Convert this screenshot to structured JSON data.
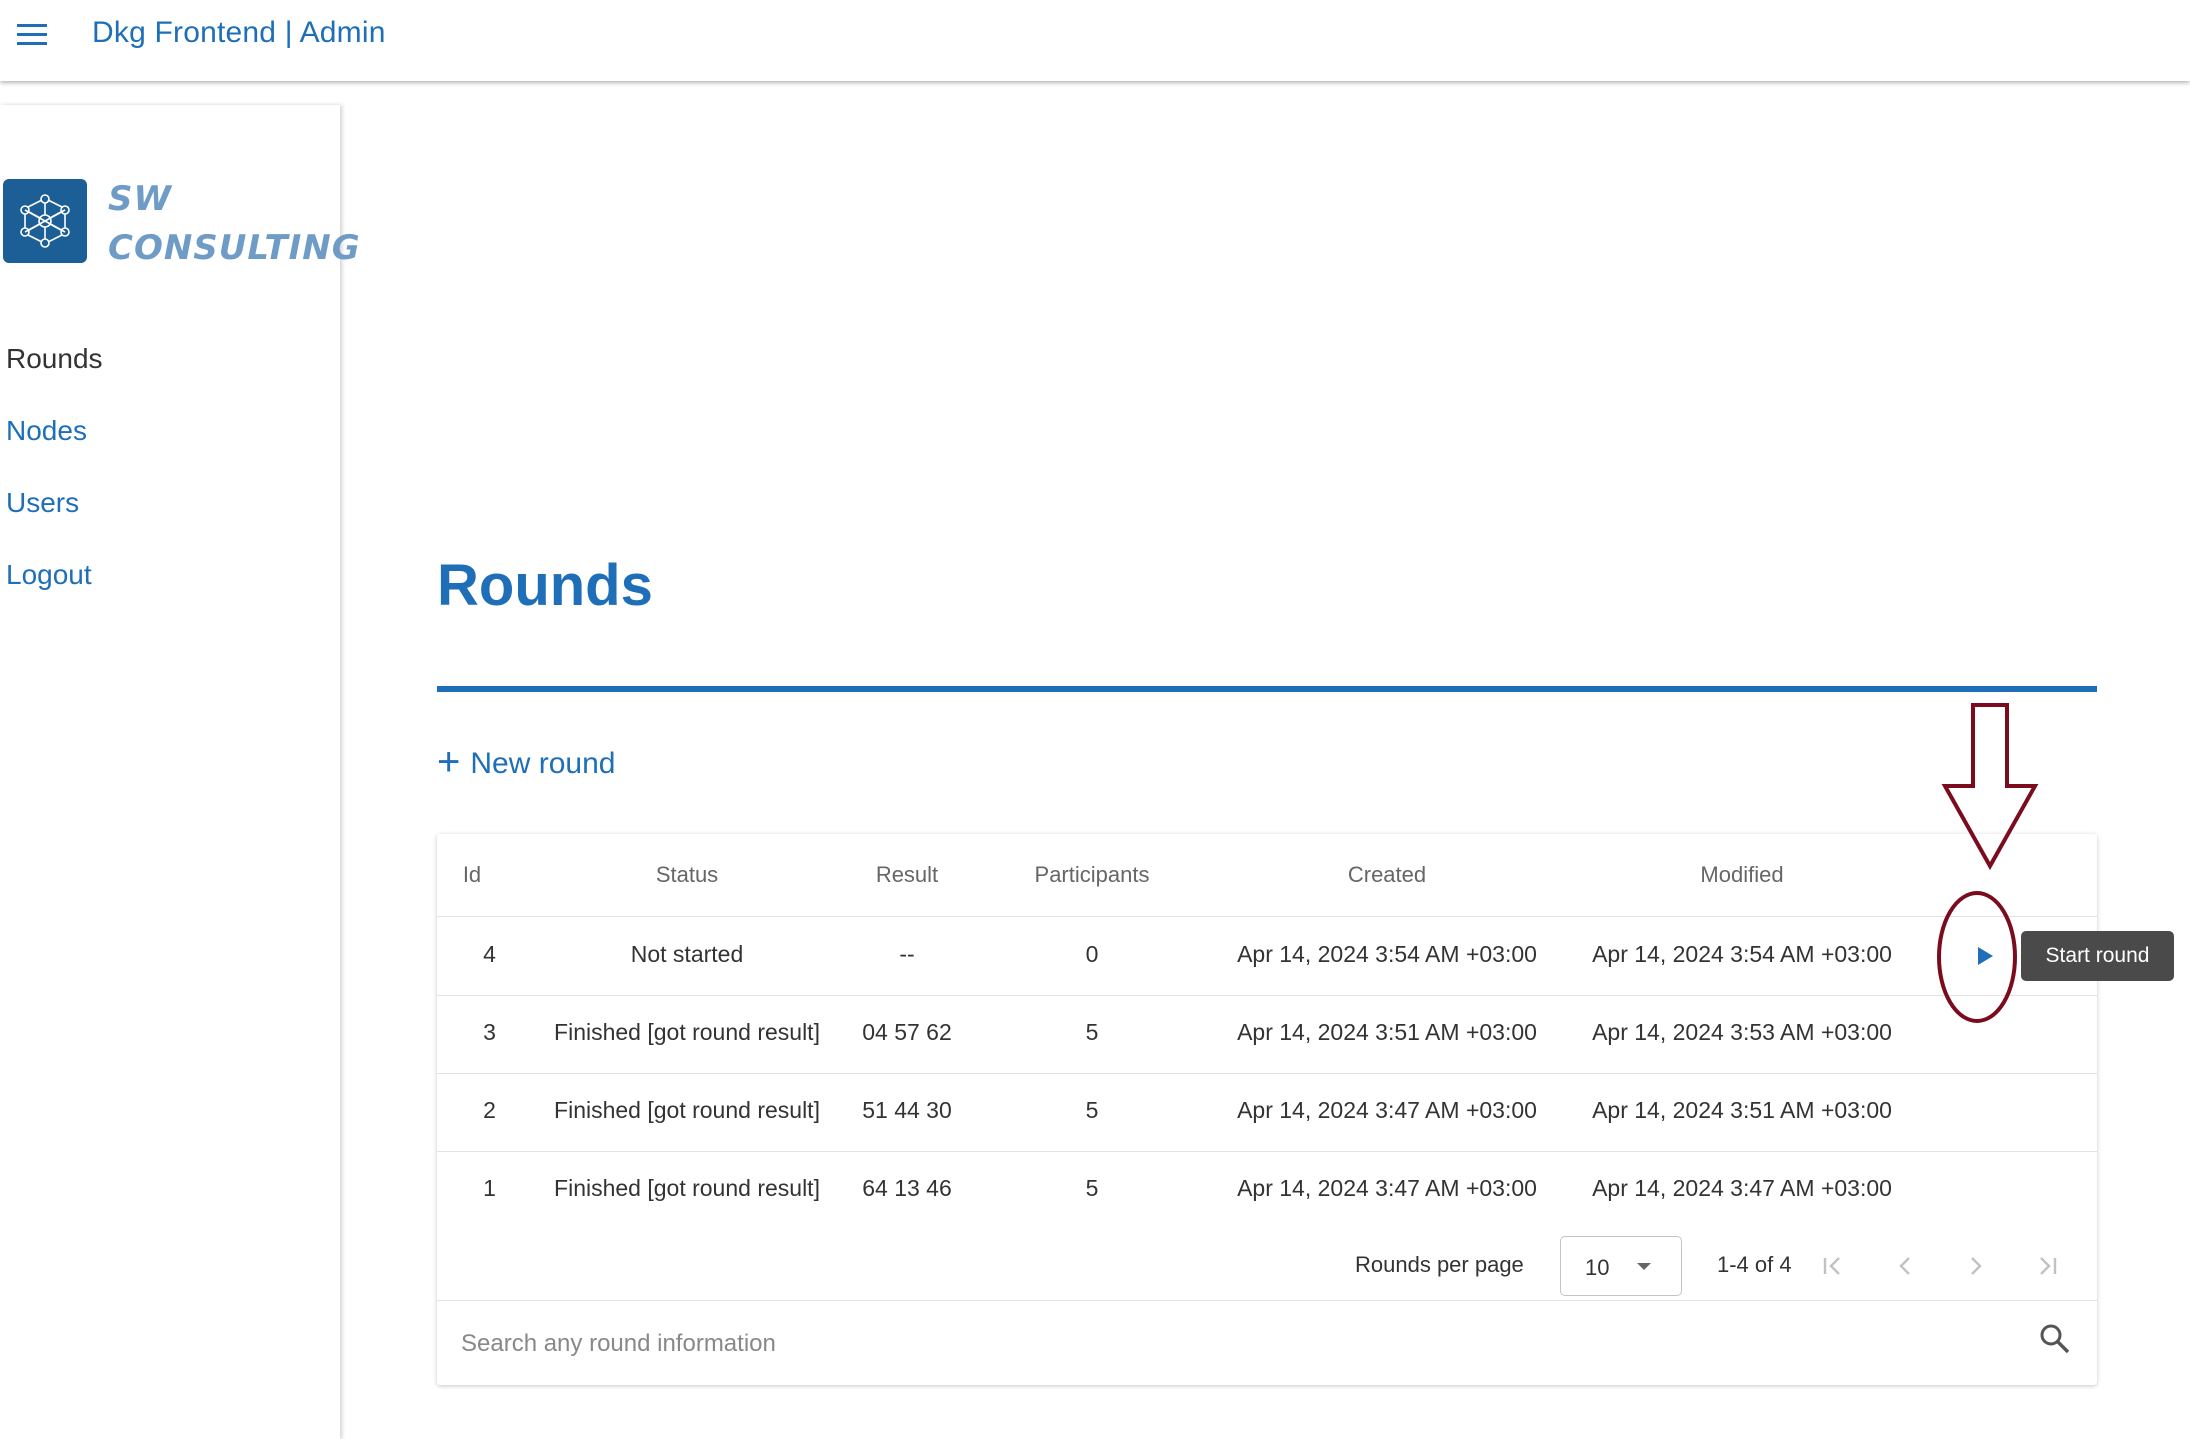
{
  "app": {
    "title": "Dkg Frontend | Admin"
  },
  "logo": {
    "line1": "SW",
    "line2": "CONSULTING"
  },
  "sidebar": {
    "items": [
      {
        "label": "Rounds",
        "active": true
      },
      {
        "label": "Nodes",
        "active": false
      },
      {
        "label": "Users",
        "active": false
      },
      {
        "label": "Logout",
        "active": false
      }
    ]
  },
  "page": {
    "title": "Rounds"
  },
  "toolbar": {
    "new_round_label": "New round"
  },
  "table": {
    "columns": [
      "Id",
      "Status",
      "Result",
      "Participants",
      "Created",
      "Modified"
    ],
    "rows": [
      {
        "id": "4",
        "status": "Not started",
        "result": "--",
        "participants": "0",
        "created": "Apr 14, 2024 3:54 AM +03:00",
        "modified": "Apr 14, 2024 3:54 AM +03:00",
        "has_start": true
      },
      {
        "id": "3",
        "status": "Finished [got round result]",
        "result": "04 57 62",
        "participants": "5",
        "created": "Apr 14, 2024 3:51 AM +03:00",
        "modified": "Apr 14, 2024 3:53 AM +03:00",
        "has_start": false
      },
      {
        "id": "2",
        "status": "Finished [got round result]",
        "result": "51 44 30",
        "participants": "5",
        "created": "Apr 14, 2024 3:47 AM +03:00",
        "modified": "Apr 14, 2024 3:51 AM +03:00",
        "has_start": false
      },
      {
        "id": "1",
        "status": "Finished [got round result]",
        "result": "64 13 46",
        "participants": "5",
        "created": "Apr 14, 2024 3:47 AM +03:00",
        "modified": "Apr 14, 2024 3:47 AM +03:00",
        "has_start": false
      }
    ]
  },
  "pagination": {
    "rows_per_page_label": "Rounds per page",
    "rows_per_page": "10",
    "range": "1-4 of 4"
  },
  "search": {
    "placeholder": "Search any round information"
  },
  "tooltip": {
    "label": "Start round"
  },
  "colors": {
    "primary": "#1e6fb8",
    "annotation": "#7a0c1e",
    "tooltip_bg": "#4a4a4a",
    "logo_bg": "#1c5f96"
  },
  "icons": [
    "menu-icon",
    "network-logo-icon",
    "plus-icon",
    "play-icon",
    "first-page-icon",
    "prev-page-icon",
    "next-page-icon",
    "last-page-icon",
    "search-icon",
    "annotation-arrow",
    "annotation-circle"
  ]
}
